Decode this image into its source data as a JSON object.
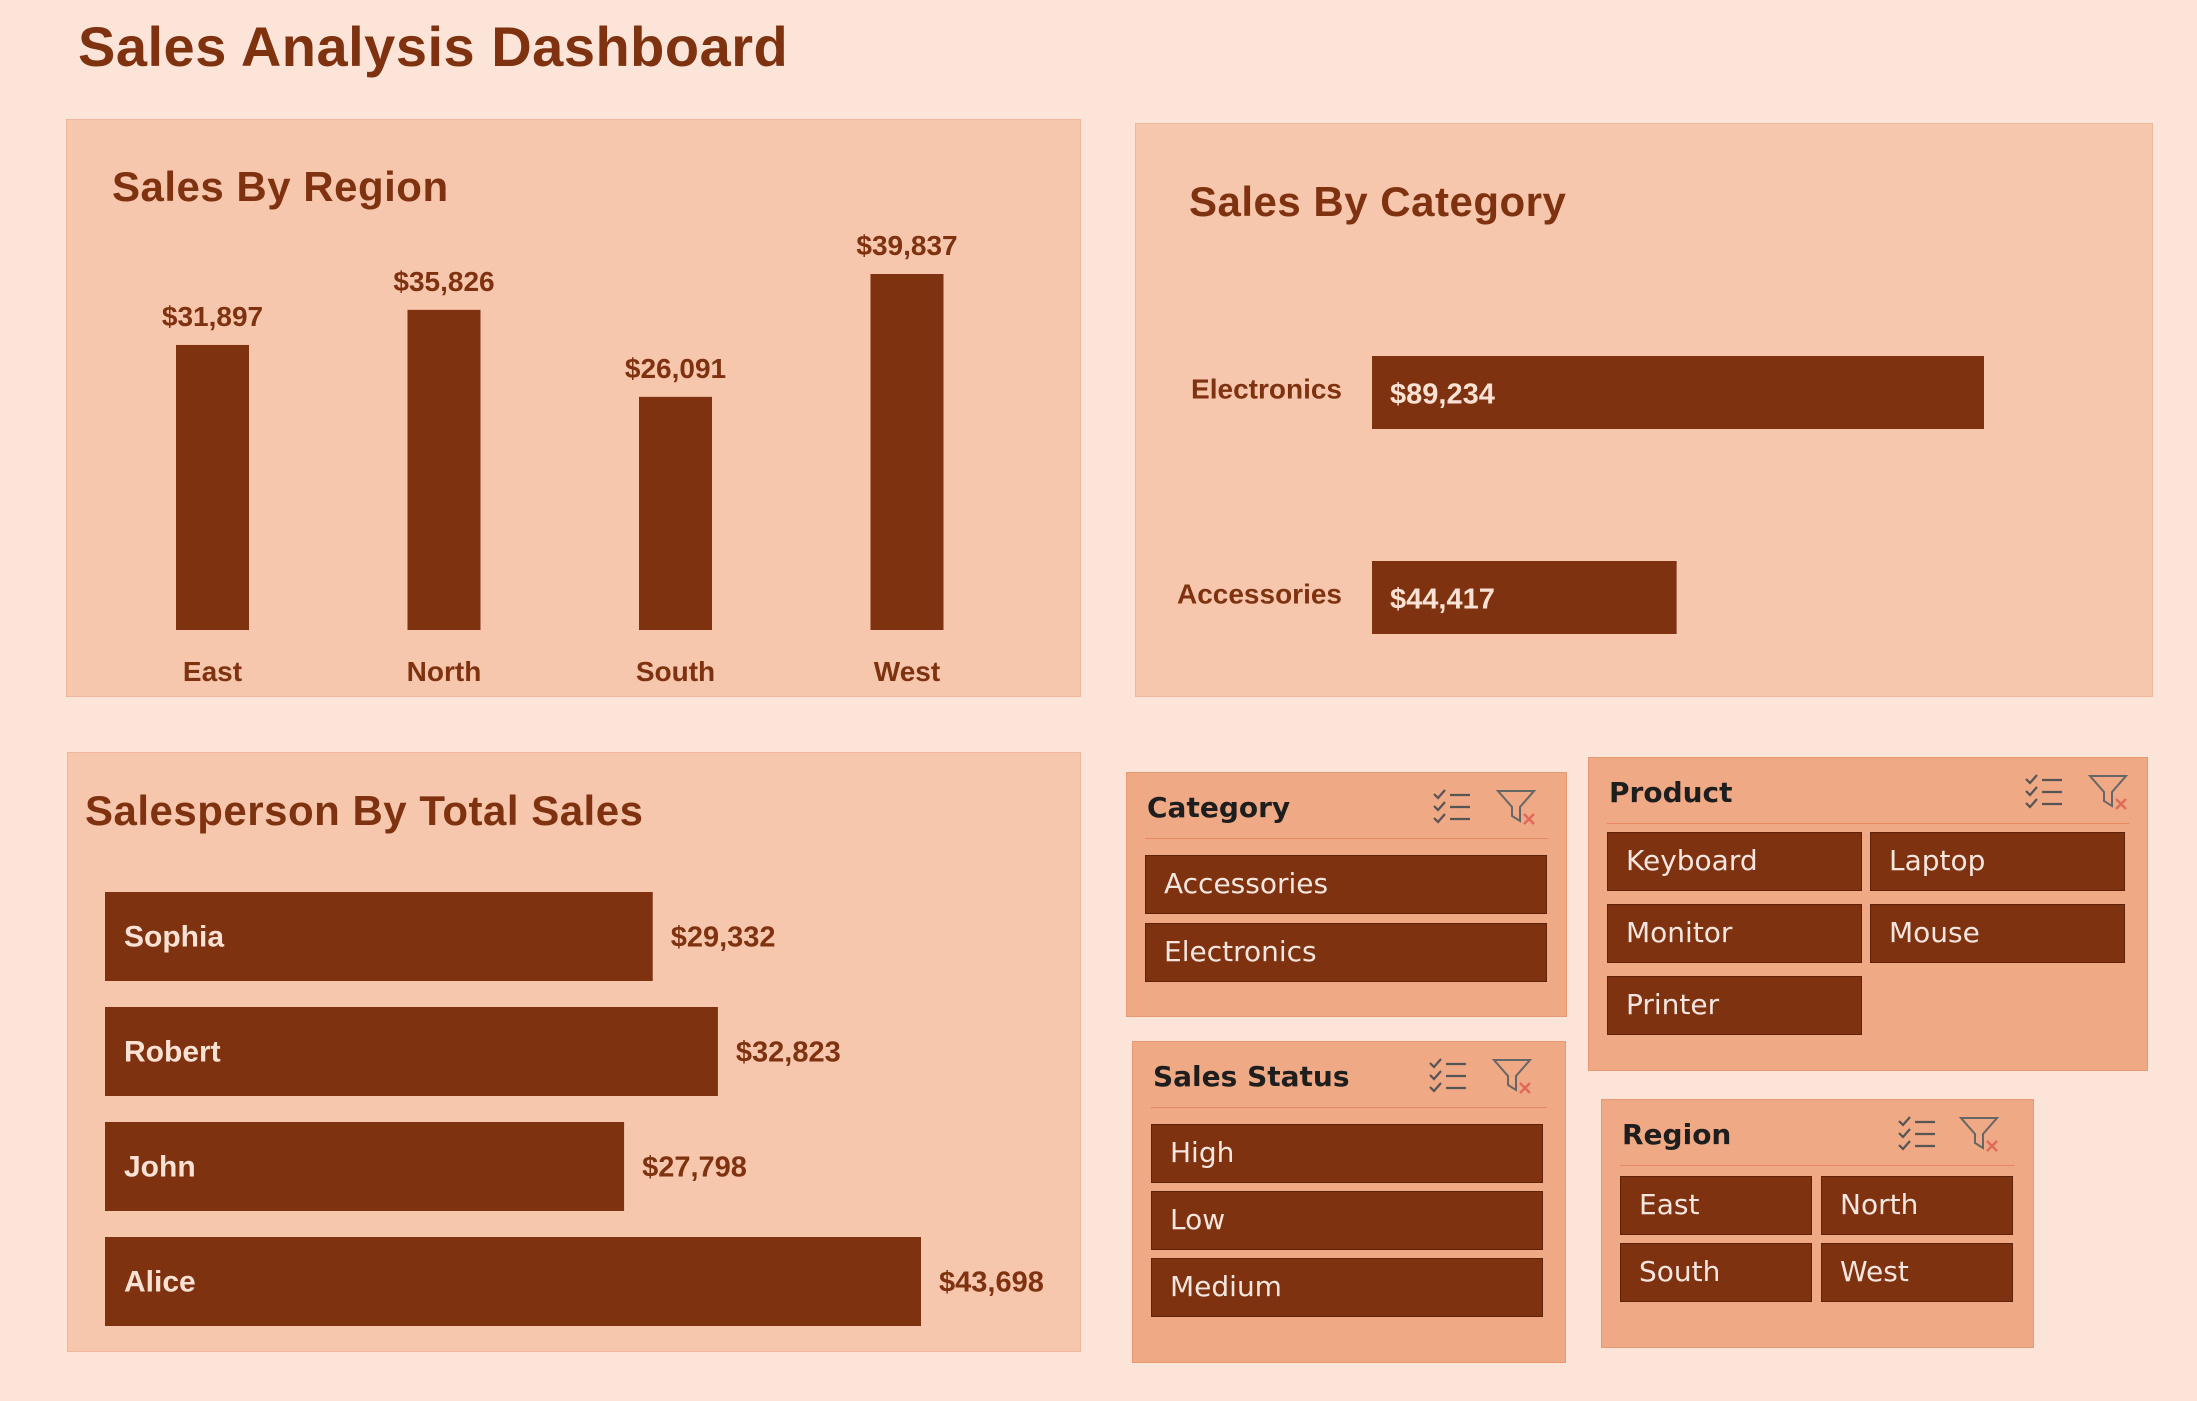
{
  "title": "Sales Analysis Dashboard",
  "colors": {
    "background": "#FCE4D8",
    "panel": "#F6C6AD",
    "bar": "#7E3210",
    "slicer": "#F0A985",
    "text": "#7E3210"
  },
  "panels": {
    "region": {
      "title": "Sales By Region"
    },
    "category": {
      "title": "Sales By Category"
    },
    "salesperson": {
      "title": "Salesperson By Total Sales"
    }
  },
  "chart_data": [
    {
      "type": "bar",
      "title": "Sales By Region",
      "categories": [
        "East",
        "North",
        "South",
        "West"
      ],
      "values": [
        31897,
        35826,
        26091,
        39837
      ],
      "value_labels": [
        "$31,897",
        "$35,826",
        "$26,091",
        "$39,837"
      ]
    },
    {
      "type": "bar",
      "orientation": "horizontal",
      "title": "Sales By Category",
      "categories": [
        "Electronics",
        "Accessories"
      ],
      "values": [
        89234,
        44417
      ],
      "value_labels": [
        "$89,234",
        "$44,417"
      ]
    },
    {
      "type": "bar",
      "orientation": "horizontal",
      "title": "Salesperson By Total Sales",
      "categories": [
        "Sophia",
        "Robert",
        "John",
        "Alice"
      ],
      "values": [
        29332,
        32823,
        27798,
        43698
      ],
      "value_labels": [
        "$29,332",
        "$32,823",
        "$27,798",
        "$43,698"
      ]
    }
  ],
  "slicers": {
    "category": {
      "title": "Category",
      "items": [
        "Accessories",
        "Electronics"
      ]
    },
    "product": {
      "title": "Product",
      "items": [
        "Keyboard",
        "Laptop",
        "Monitor",
        "Mouse",
        "Printer"
      ]
    },
    "sales_status": {
      "title": "Sales Status",
      "items": [
        "High",
        "Low",
        "Medium"
      ]
    },
    "region": {
      "title": "Region",
      "items": [
        "East",
        "North",
        "South",
        "West"
      ]
    }
  },
  "icons": {
    "multi_select": "multi-select-icon",
    "clear_filter": "clear-filter-icon"
  }
}
